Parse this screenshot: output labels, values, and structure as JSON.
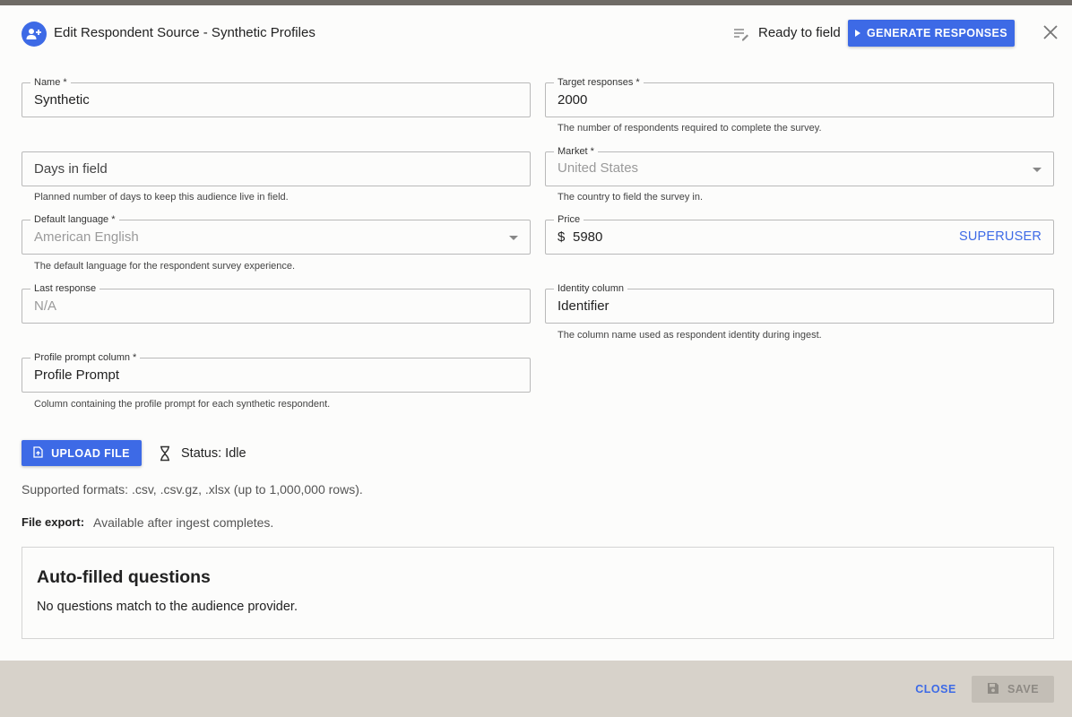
{
  "header": {
    "title": "Edit Respondent Source - Synthetic Profiles",
    "status": "Ready to field",
    "generate_label": "GENERATE RESPONSES",
    "avatar_icon": "group-add-icon",
    "ready_icon": "edit-list-icon",
    "close_icon": "close-icon"
  },
  "fields": {
    "name": {
      "label": "Name *",
      "value": "Synthetic"
    },
    "target_responses": {
      "label": "Target responses *",
      "value": "2000",
      "helper": "The number of respondents required to complete the survey."
    },
    "days_in_field": {
      "placeholder": "Days in field",
      "helper": "Planned number of days to keep this audience live in field."
    },
    "market": {
      "label": "Market *",
      "value": "United States",
      "helper": "The country to field the survey in."
    },
    "default_language": {
      "label": "Default language *",
      "value": "American English",
      "helper": "The default language for the respondent survey experience."
    },
    "price": {
      "label": "Price",
      "currency": "$",
      "value": "5980",
      "badge": "SUPERUSER"
    },
    "last_response": {
      "label": "Last response",
      "value": "N/A"
    },
    "identity_column": {
      "label": "Identity column",
      "value": "Identifier",
      "helper": "The column name used as respondent identity during ingest."
    },
    "profile_prompt_column": {
      "label": "Profile prompt column *",
      "value": "Profile Prompt",
      "helper": "Column containing the profile prompt for each synthetic respondent."
    }
  },
  "upload": {
    "button_label": "UPLOAD FILE",
    "status": "Status: Idle",
    "formats": "Supported formats: .csv, .csv.gz, .xlsx (up to 1,000,000 rows).",
    "export_label": "File export:",
    "export_text": "Available after ingest completes."
  },
  "autofill": {
    "heading": "Auto-filled questions",
    "message": "No questions match to the audience provider."
  },
  "footer": {
    "close_label": "CLOSE",
    "save_label": "SAVE"
  },
  "colors": {
    "accent": "#3d6ae6",
    "footer_bg": "#d7d2ca",
    "topbar": "#6f6b66"
  }
}
